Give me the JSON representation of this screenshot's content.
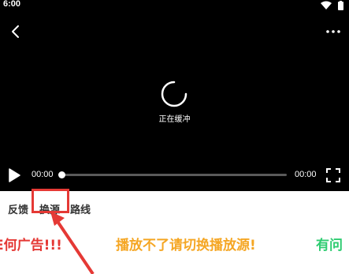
{
  "status_bar": {
    "time": "6:00"
  },
  "player": {
    "buffering_text": "正在缓冲",
    "current_time": "00:00",
    "total_time": "00:00",
    "progress_fraction": 0.0
  },
  "tabs": [
    {
      "label": "反馈"
    },
    {
      "label": "换源"
    },
    {
      "label": "路线"
    }
  ],
  "marquee": {
    "messages": [
      {
        "text": "E何广告!!!",
        "color": "#e53935"
      },
      {
        "text": "播放不了请切换播放源!",
        "color": "#f5a623"
      },
      {
        "text": "有问",
        "color": "#2ecc71"
      }
    ]
  },
  "icons": {
    "back": "back-arrow-icon",
    "more": "more-vertical-icon",
    "play": "play-icon",
    "fullscreen": "fullscreen-icon",
    "loading": "loading-spinner-icon",
    "wifi": "wifi-icon",
    "battery": "battery-icon"
  },
  "colors": {
    "player_bg": "#000000",
    "annotation": "#e53935"
  }
}
